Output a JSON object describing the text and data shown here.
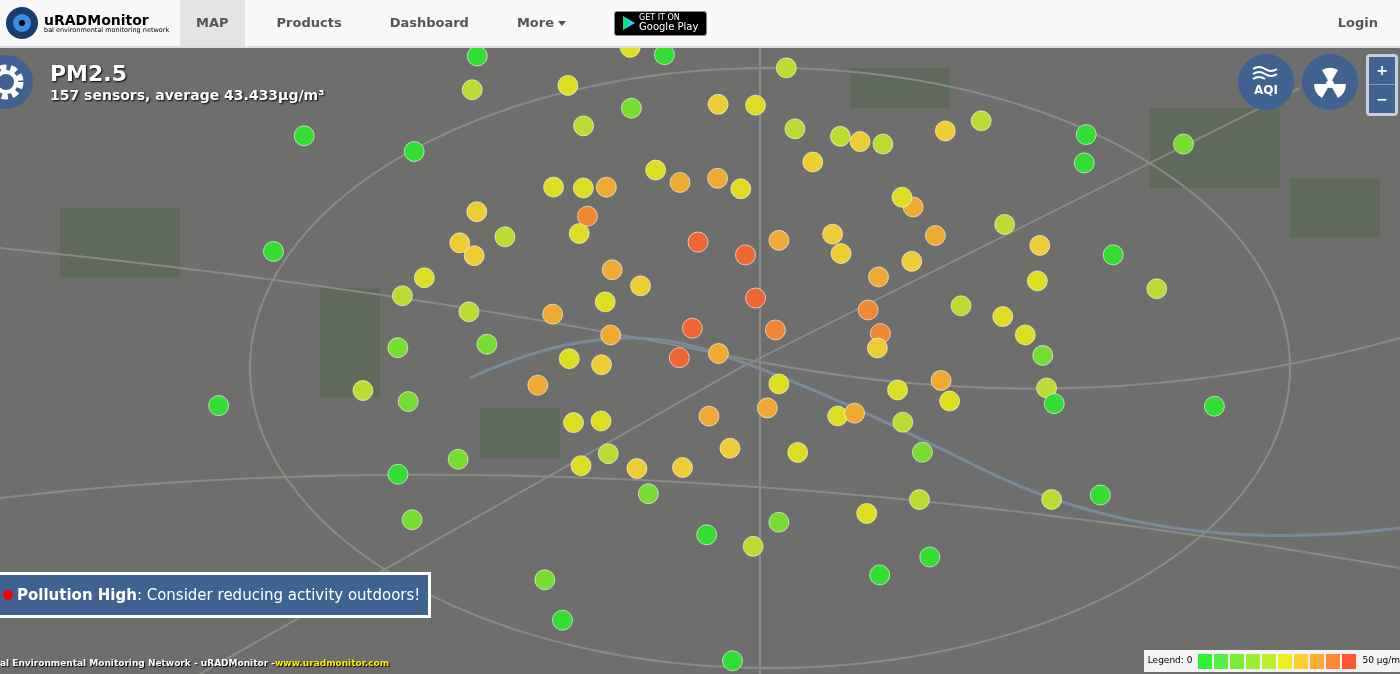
{
  "header": {
    "brand": "uRADMonitor",
    "tagline": "bal environmental monitoring network",
    "nav": [
      {
        "label": "MAP",
        "selected": true,
        "kind": "link"
      },
      {
        "label": "Products",
        "selected": false,
        "kind": "link"
      },
      {
        "label": "Dashboard",
        "selected": false,
        "kind": "link"
      },
      {
        "label": "More",
        "selected": false,
        "kind": "dropdown"
      }
    ],
    "store_badge": {
      "small": "GET IT ON",
      "big": "Google Play"
    },
    "login": "Login"
  },
  "map": {
    "parameter": "PM2.5",
    "summary": "157 sensors, average 43.433µg/m³",
    "aqi_label": "AQI",
    "zoom_in": "+",
    "zoom_out": "−",
    "alert": {
      "color": "#ff0000",
      "text": "**Pollution High**: Consider reducing activity outdoors!"
    },
    "footer": {
      "text": "al Environmental Monitoring Network - uRADMonitor - ",
      "link": "www.uradmonitor.com"
    },
    "legend": {
      "label": "Legend: 0",
      "unit": "50 µg/m",
      "swatches": [
        {
          "color": "#33ee33"
        },
        {
          "color": "#55ee44"
        },
        {
          "color": "#77ee33"
        },
        {
          "color": "#99ee33"
        },
        {
          "color": "#bbee33"
        },
        {
          "color": "#eeee22"
        },
        {
          "color": "#ffcc33"
        },
        {
          "color": "#ffaa33"
        },
        {
          "color": "#ff8833"
        },
        {
          "color": "#ff5533"
        }
      ]
    }
  }
}
